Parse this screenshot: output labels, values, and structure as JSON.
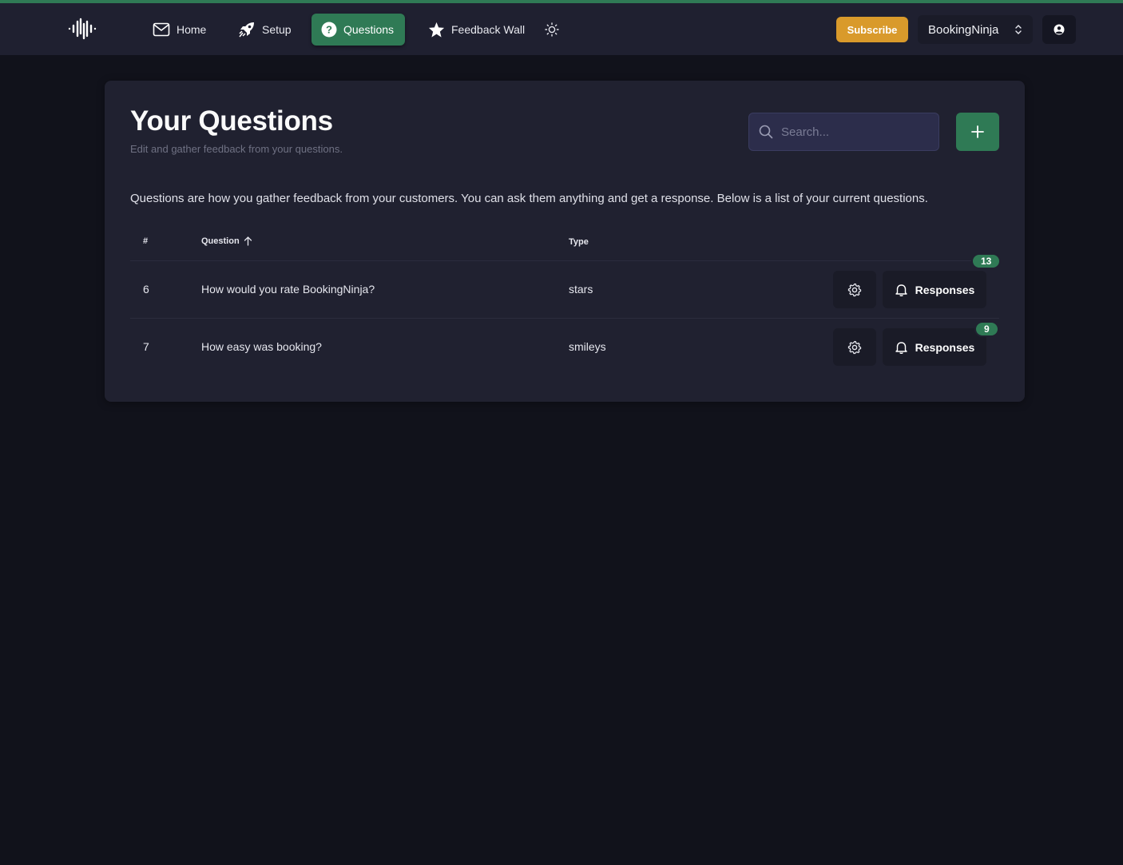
{
  "nav": {
    "items": [
      {
        "label": "Home",
        "icon": "mail-icon"
      },
      {
        "label": "Setup",
        "icon": "rocket-icon"
      },
      {
        "label": "Questions",
        "icon": "question-circle-icon",
        "active": true
      },
      {
        "label": "Feedback Wall",
        "icon": "star-icon"
      }
    ],
    "theme_toggle_icon": "sun-icon",
    "subscribe_label": "Subscribe",
    "project_name": "BookingNinja",
    "account_icon": "user-circle-icon"
  },
  "page": {
    "title": "Your Questions",
    "subtitle": "Edit and gather feedback from your questions.",
    "search_placeholder": "Search...",
    "add_icon": "plus-icon",
    "description": "Questions are how you gather feedback from your customers. You can ask them anything and get a response. Below is a list of your current questions."
  },
  "table": {
    "columns": [
      "#",
      "Question",
      "Type"
    ],
    "sort_icon": "arrow-up-icon",
    "rows": [
      {
        "id": "6",
        "question": "How would you rate BookingNinja?",
        "type": "stars",
        "responses_label": "Responses",
        "response_count": "13"
      },
      {
        "id": "7",
        "question": "How easy was booking?",
        "type": "smileys",
        "responses_label": "Responses",
        "response_count": "9"
      }
    ]
  },
  "colors": {
    "accent_green": "#2f7a55",
    "subscribe_orange": "#d99a2b",
    "background": "#11121b",
    "card": "#202130"
  }
}
